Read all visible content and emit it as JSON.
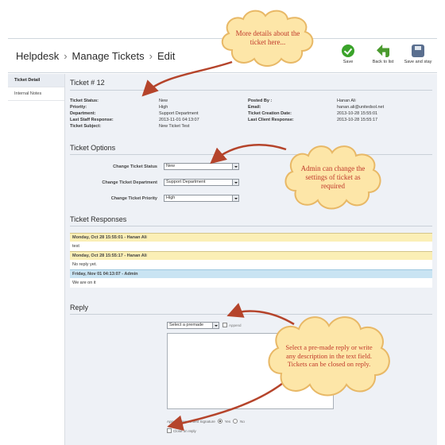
{
  "header": {
    "breadcrumbs": [
      "Helpdesk",
      "Manage Tickets",
      "Edit"
    ],
    "separator": "›",
    "toolbar": [
      {
        "label": "Save",
        "icon": "checkmark-icon"
      },
      {
        "label": "Back to list",
        "icon": "back-arrow-icon"
      },
      {
        "label": "Save and stay",
        "icon": "floppy-disk-icon"
      }
    ]
  },
  "sidebar": {
    "items": [
      {
        "label": "Ticket Detail",
        "active": true
      },
      {
        "label": "Internal Notes",
        "active": false
      }
    ]
  },
  "ticket": {
    "title": "Ticket # 12",
    "fields": [
      {
        "k1": "Ticket Status:",
        "v1": "New",
        "k2": "Posted By :",
        "v2": "Hanan Ali"
      },
      {
        "k1": "Priority:",
        "v1": "High",
        "k2": "Email:",
        "v2": "hanan.ali@unitedsol.net"
      },
      {
        "k1": "Department:",
        "v1": "Support Department",
        "k2": "Ticket Creation Date:",
        "v2": "2013-10-28 15:55:01"
      },
      {
        "k1": "Last Staff Response:",
        "v1": "2013-11-01 04:13:07",
        "k2": "Last Client Response:",
        "v2": "2013-10-28 15:55:17"
      },
      {
        "k1": "Ticket Subject:",
        "v1": "New Ticket Test",
        "k2": "",
        "v2": ""
      }
    ]
  },
  "options": {
    "title": "Ticket Options",
    "status": {
      "label": "Change Ticket Status",
      "value": "New"
    },
    "department": {
      "label": "Change Ticket Department",
      "value": "Support Department"
    },
    "priority": {
      "label": "Change Ticket Priority",
      "value": "High"
    }
  },
  "responses": {
    "title": "Ticket Responses",
    "items": [
      {
        "header": "Monday, Oct 28 15:55:01 - Hanan Ali",
        "body": "test",
        "color": "yellow"
      },
      {
        "header": "Monday, Oct 28 15:55:17 - Hanan Ali",
        "body": "No reply yet.",
        "color": "yellow"
      },
      {
        "header": "Friday, Nov 01 04:13:07 - Admin",
        "body": "We are on it",
        "color": "blue"
      }
    ]
  },
  "reply": {
    "title": "Reply",
    "premade_value": "Select a premade",
    "append_label": "Append",
    "signature_label": "Append Department Signature",
    "yes_label": "Yes",
    "no_label": "No",
    "close_label": "Close on reply"
  },
  "callouts": {
    "details": "More details about the ticket here...",
    "settings": "Admin can change the settings of ticket as required",
    "reply": "Select a pre-made reply or write any description in the text field. Tickets can be closed on reply."
  },
  "colors": {
    "callout_fill": "#fde6a8",
    "callout_stroke": "#e8b866",
    "callout_text": "#c0392b",
    "arrow": "#b5442b",
    "response_yellow": "#fbefb6",
    "response_blue": "#c9e4f3",
    "save_green": "#3aa32a"
  }
}
